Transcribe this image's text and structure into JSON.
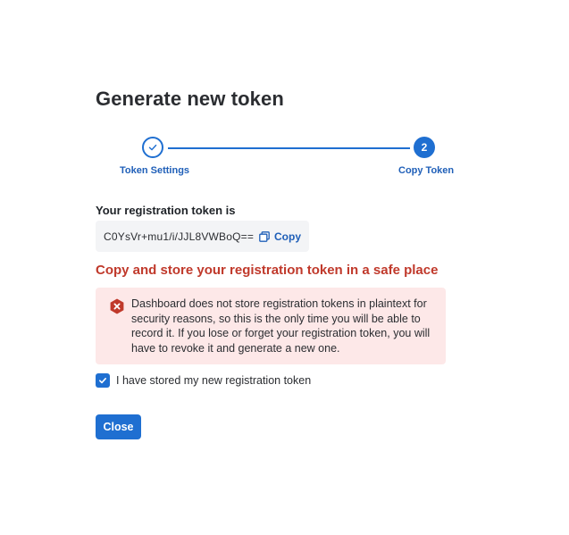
{
  "dialog": {
    "title": "Generate new token"
  },
  "stepper": {
    "steps": [
      {
        "label": "Token Settings",
        "state": "completed",
        "marker": "check-icon"
      },
      {
        "label": "Copy Token",
        "state": "active",
        "marker": "2"
      }
    ],
    "active_color": "#1f6fd1"
  },
  "token": {
    "label": "Your registration token is",
    "value": "C0YsVr+mu1/i/JJL8VWBoQ==",
    "copy_label": "Copy",
    "copy_icon": "copy-icon"
  },
  "warning": {
    "heading": "Copy and store your registration token in a safe place",
    "heading_color": "#c0392b",
    "icon": "error-octagon-icon",
    "message": "Dashboard does not store registration tokens in plaintext for security reasons, so this is the only time you will be able to record it. If you lose or forget your registration token, you will have to revoke it and generate a new one.",
    "background": "#fde8e8"
  },
  "confirmation": {
    "label": "I have stored my new registration token",
    "checked": true
  },
  "actions": {
    "close_label": "Close"
  }
}
